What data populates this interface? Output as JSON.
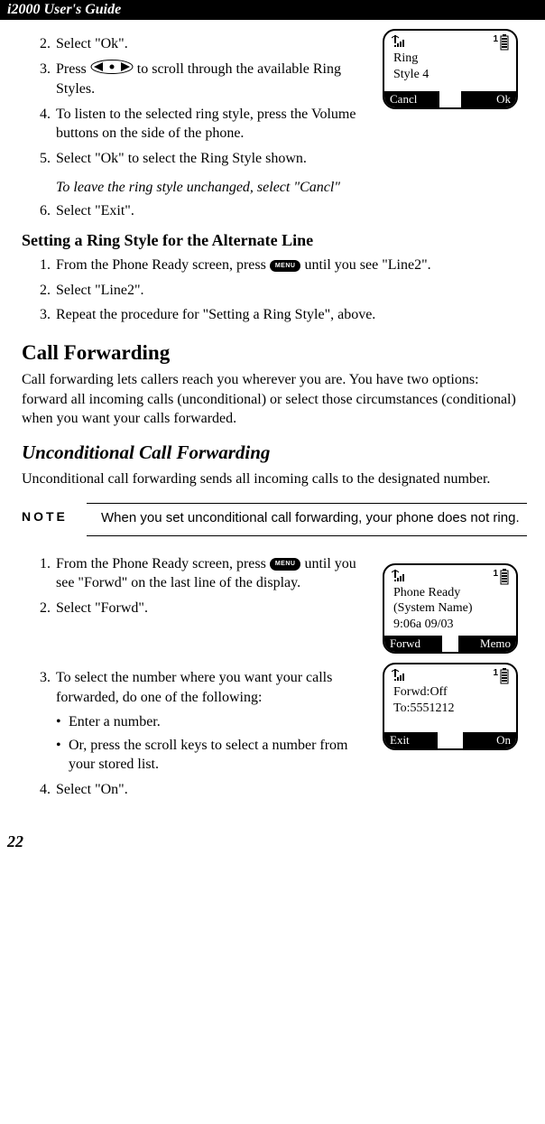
{
  "header": "i2000 User's Guide",
  "page_number": "22",
  "steps_top": [
    {
      "n": "2.",
      "t": "Select \"Ok\"."
    },
    {
      "n": "3.",
      "t_pre": "Press ",
      "t_post": " to scroll through the available Ring Styles.",
      "icon": "scroll"
    },
    {
      "n": "4.",
      "t": "To listen to the selected ring style, press the Volume buttons on the side of the phone."
    },
    {
      "n": "5.",
      "t": "Select \"Ok\" to select the Ring Style shown."
    }
  ],
  "italic_leave": "To leave the ring style unchanged, select \"Cancl\"",
  "steps_top2": [
    {
      "n": "6.",
      "t": "Select \"Exit\"."
    }
  ],
  "h2_alt": "Setting a Ring Style for the Alternate Line",
  "steps_alt": [
    {
      "n": "1.",
      "t_pre": "From the Phone Ready screen, press  ",
      "t_post": "  until you see \"Line2\".",
      "icon": "menu"
    },
    {
      "n": "2.",
      "t": "Select \"Line2\"."
    },
    {
      "n": "3.",
      "t": "Repeat the procedure for \"Setting a Ring Style\", above."
    }
  ],
  "h1_call_fwd": "Call Forwarding",
  "para_call_fwd": "Call forwarding lets callers reach you wherever you are. You have two options: forward all incoming calls (unconditional) or select those circumstances (conditional) when you want your calls forwarded.",
  "h1_uncond": "Unconditional Call Forwarding",
  "para_uncond": "Unconditional call forwarding sends all incoming calls to the designated number.",
  "note": {
    "label": "NOTE",
    "text": "When you set unconditional call forwarding, your phone does not ring."
  },
  "steps_fwd1": [
    {
      "n": "1.",
      "t_pre": "From the Phone Ready screen, press ",
      "t_mid_icon": "menu",
      "t_post": " until you see \"Forwd\" on the last line of the display."
    },
    {
      "n": "2.",
      "t": "Select \"Forwd\"."
    }
  ],
  "steps_fwd2": [
    {
      "n": "3.",
      "t": "To select the number where you want your calls forwarded, do one of the following:"
    }
  ],
  "bullets_fwd": [
    "Enter a number.",
    "Or, press the scroll keys to select a number from your stored list."
  ],
  "steps_fwd3": [
    {
      "n": "4.",
      "t": "Select \"On\"."
    }
  ],
  "screen1": {
    "line1": "Ring",
    "line2": "Style 4",
    "sk_left": "Cancl",
    "sk_right": "Ok"
  },
  "screen2": {
    "line1": "Phone Ready",
    "line2": "(System Name)",
    "line3": "9:06a   09/03",
    "sk_left": "Forwd",
    "sk_right": "Memo"
  },
  "screen3": {
    "line1": "Forwd:Off",
    "line2": "To:5551212",
    "sk_left": "Exit",
    "sk_right": "On"
  }
}
